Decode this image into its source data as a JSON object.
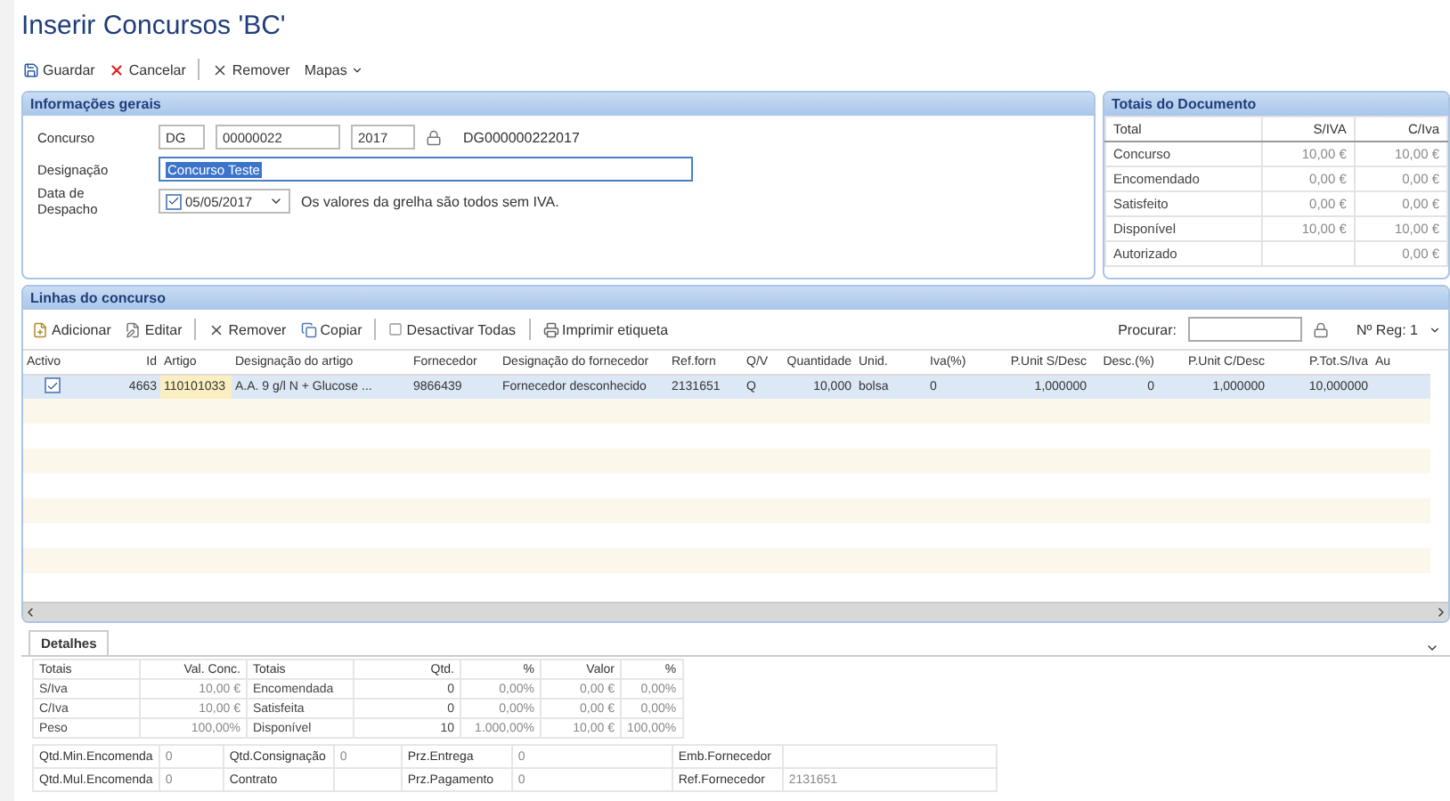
{
  "title": "Inserir Concursos 'BC'",
  "toolbar": [
    {
      "kind": "save",
      "label": "Guardar"
    },
    {
      "kind": "cancel",
      "label": "Cancelar"
    },
    {
      "kind": "remove",
      "label": "Remover"
    },
    {
      "kind": "menu",
      "label": "Mapas"
    }
  ],
  "general": {
    "title": "Informações gerais",
    "concurso": {
      "label": "Concurso",
      "serie": "DG",
      "number": "00000022",
      "year": "2017",
      "code": "DG000000222017"
    },
    "designacao": {
      "label": "Designação",
      "value": "Concurso Teste"
    },
    "despacho": {
      "label": "Data de Despacho",
      "checked": true,
      "date": "05/05/2017",
      "note": "Os valores da grelha são todos sem IVA."
    }
  },
  "totals": {
    "title": "Totais do Documento",
    "columns": [
      "Total",
      "S/IVA",
      "C/Iva"
    ],
    "rows": [
      [
        "Concurso",
        "10,00 €",
        "10,00 €"
      ],
      [
        "Encomendado",
        "0,00 €",
        "0,00 €"
      ],
      [
        "Satisfeito",
        "0,00 €",
        "0,00 €"
      ],
      [
        "Disponível",
        "10,00 €",
        "10,00 €"
      ],
      [
        "Autorizado",
        "",
        "0,00 €"
      ]
    ]
  },
  "lines": {
    "title": "Linhas do concurso",
    "toolbar": [
      {
        "kind": "add",
        "label": "Adicionar"
      },
      {
        "kind": "edit",
        "label": "Editar"
      },
      {
        "kind": "remove",
        "label": "Remover"
      },
      {
        "kind": "copy",
        "label": "Copiar"
      },
      {
        "kind": "toggle",
        "label": "Desactivar Todas"
      },
      {
        "kind": "print",
        "label": "Imprimir etiqueta"
      }
    ],
    "search_label": "Procurar:",
    "records": "Nº Reg: 1",
    "columns": [
      "Activo",
      "Id",
      "Artigo",
      "Designação do artigo",
      "Fornecedor",
      "Designação do fornecedor",
      "Ref.forn",
      "Q/V",
      "Quantidade",
      "Unid.",
      "Iva(%)",
      "P.Unit S/Desc",
      "Desc.(%)",
      "P.Unit C/Desc",
      "P.Tot.S/Iva",
      "Au"
    ],
    "rows": [
      {
        "selected": true,
        "active": true,
        "cells": [
          "",
          "4663",
          "110101033",
          "A.A. 9 g/l N + Glucose ...",
          "9866439",
          "Fornecedor desconhecido",
          "2131651",
          "Q",
          "10,000",
          "bolsa",
          "0",
          "1,000000",
          "0",
          "1,000000",
          "10,000000",
          ""
        ]
      }
    ]
  },
  "details": {
    "tab": "Detalhes",
    "columns": [
      "Totais",
      "Val. Conc.",
      "Totais",
      "Qtd.",
      "%",
      "Valor",
      "%"
    ],
    "rows": [
      [
        "S/Iva",
        "10,00 €",
        "Encomendada",
        "0",
        "0,00%",
        "0,00 €",
        "0,00%"
      ],
      [
        "C/Iva",
        "10,00 €",
        "Satisfeita",
        "0",
        "0,00%",
        "0,00 €",
        "0,00%"
      ],
      [
        "Peso",
        "100,00%",
        "Disponível",
        "10",
        "1.000,00%",
        "10,00 €",
        "100,00%"
      ]
    ],
    "fields": [
      [
        {
          "label": "Qtd.Min.Encomenda",
          "value": "0"
        },
        {
          "label": "Qtd.Consignação",
          "value": "0"
        },
        {
          "label": "Prz.Entrega",
          "value": "0"
        },
        {
          "label": "Emb.Fornecedor"
        }
      ],
      [
        {
          "label": "Qtd.Mul.Encomenda",
          "value": "0"
        },
        {
          "label": "Contrato"
        },
        {
          "label": "Prz.Pagamento",
          "value": "0"
        },
        {
          "label": "Ref.Fornecedor",
          "value": "2131651"
        }
      ]
    ]
  }
}
